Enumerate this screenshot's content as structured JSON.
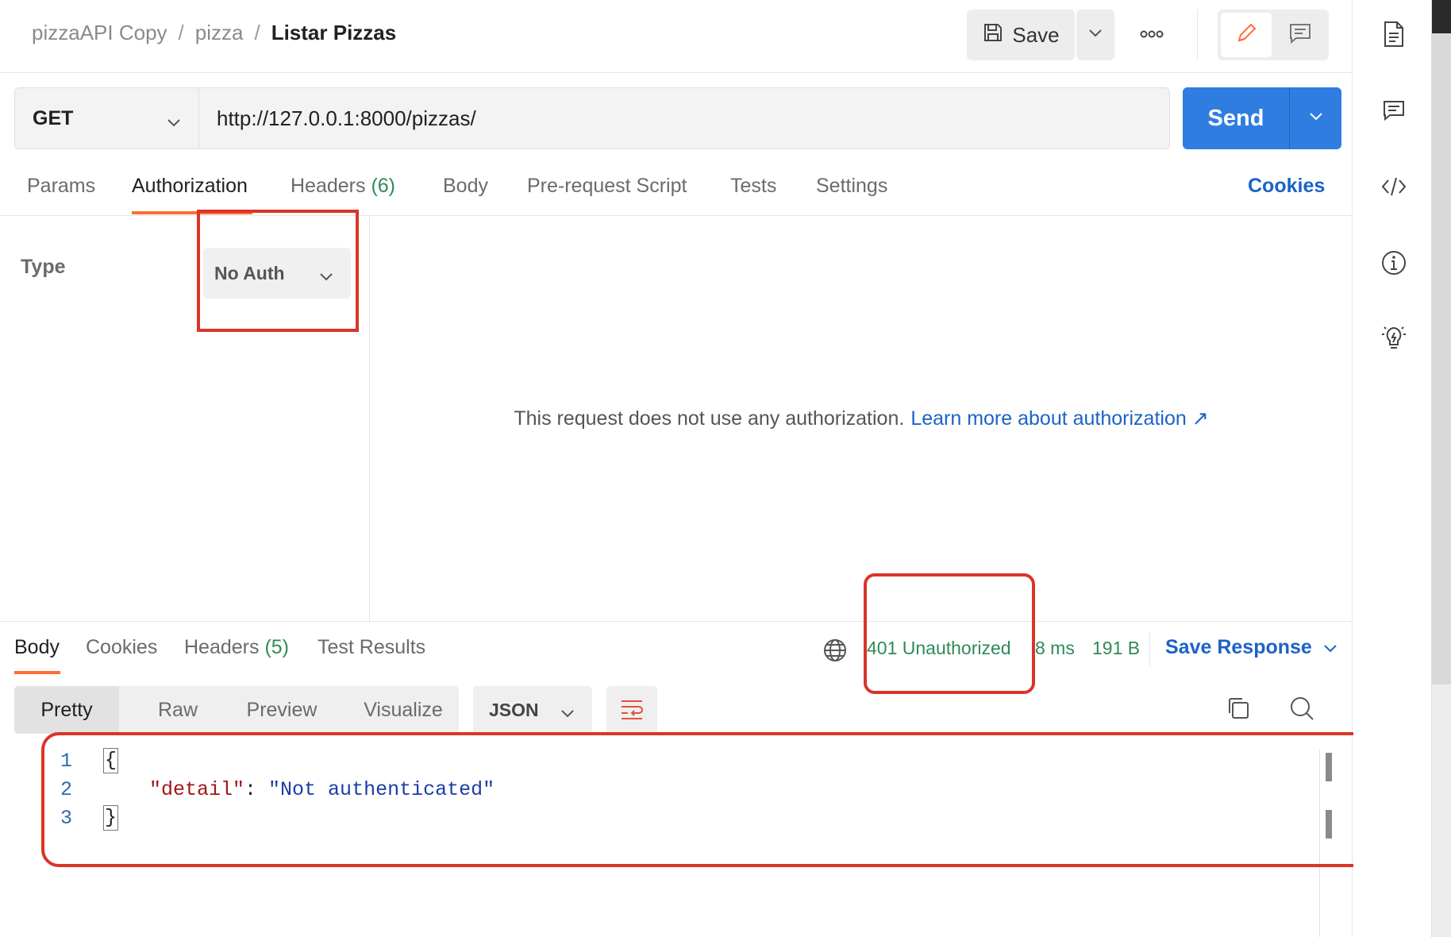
{
  "header": {
    "breadcrumb": {
      "collection": "pizzaAPI Copy",
      "sep1": "/",
      "folder": "pizza",
      "sep2": "/",
      "request": "Listar Pizzas"
    },
    "save_label": "Save",
    "more_label": "ooo"
  },
  "request": {
    "method": "GET",
    "url": "http://127.0.0.1:8000/pizzas/",
    "send_label": "Send"
  },
  "request_tabs": {
    "params": "Params",
    "authorization": "Authorization",
    "headers": "Headers",
    "headers_count": "(6)",
    "body": "Body",
    "prerequest": "Pre-request Script",
    "tests": "Tests",
    "settings": "Settings",
    "cookies": "Cookies",
    "active": "Authorization"
  },
  "auth": {
    "type_label": "Type",
    "type_value": "No Auth",
    "message": "This request does not use any authorization.",
    "learn_more": "Learn more about authorization ↗"
  },
  "response": {
    "tabs": {
      "body": "Body",
      "cookies": "Cookies",
      "headers": "Headers",
      "headers_count": "(5)",
      "test_results": "Test Results"
    },
    "status": "401 Unauthorized",
    "time": "8 ms",
    "size": "191 B",
    "save_response": "Save Response",
    "formats": {
      "pretty": "Pretty",
      "raw": "Raw",
      "preview": "Preview",
      "visualize": "Visualize"
    },
    "language": "JSON",
    "code": {
      "line_numbers": [
        "1",
        "2",
        "3"
      ],
      "open_brace": "{",
      "key": "\"detail\"",
      "colon": ": ",
      "value": "\"Not authenticated\"",
      "close_brace": "}"
    }
  },
  "colors": {
    "accent_orange": "#ff6c37",
    "send_blue": "#2f7de1",
    "link_blue": "#1b63c6",
    "status_green": "#2e8b57",
    "annotation_red": "#d9352a"
  },
  "icons": {
    "right_rail": [
      "document-icon",
      "comment-icon",
      "code-icon",
      "info-icon",
      "lightbulb-icon"
    ]
  }
}
